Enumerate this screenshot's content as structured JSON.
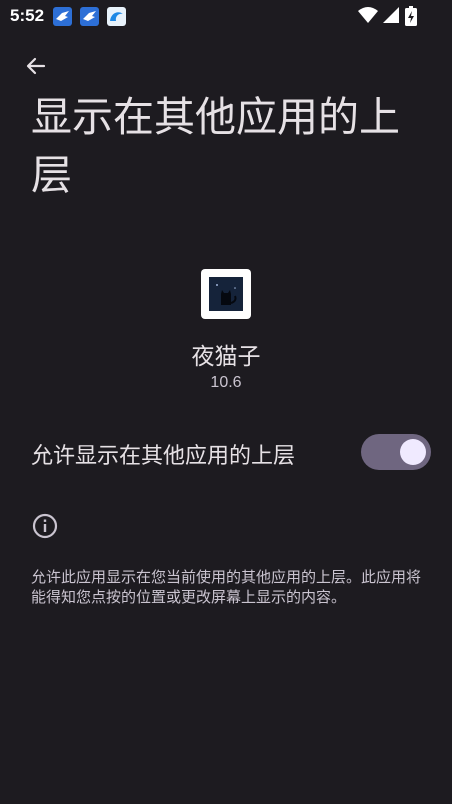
{
  "status_bar": {
    "time": "5:52"
  },
  "header": {
    "title": "显示在其他应用的上层"
  },
  "app": {
    "name": "夜猫子",
    "version": "10.6"
  },
  "permission": {
    "label": "允许显示在其他应用的上层",
    "enabled": true
  },
  "info": {
    "description": "允许此应用显示在您当前使用的其他应用的上层。此应用将能得知您点按的位置或更改屏幕上显示的内容。"
  },
  "colors": {
    "background": "#1d1b20",
    "toggle_track": "#6f6680",
    "toggle_thumb": "#f0eaff"
  }
}
